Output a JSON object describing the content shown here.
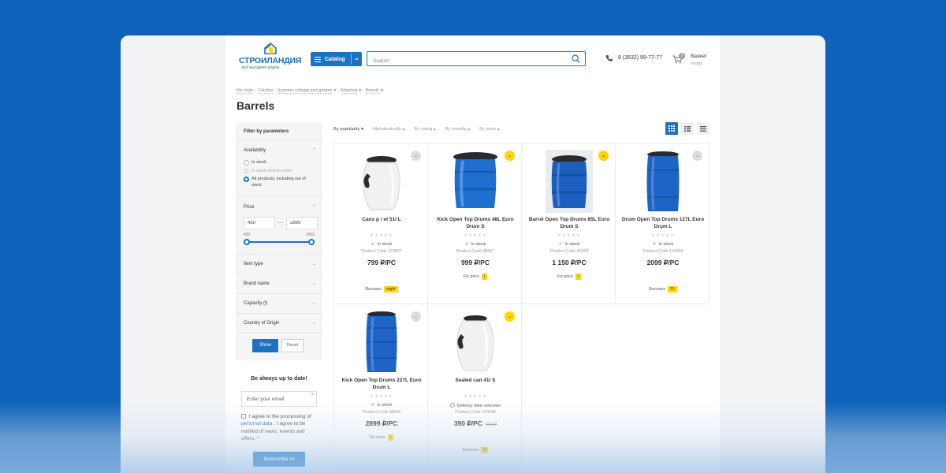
{
  "header": {
    "logo_name": "СТРОИЛАНДИЯ",
    "logo_tagline": "всё выгоднее рядом",
    "catalog_label": "Catalog",
    "search_placeholder": "Search",
    "phone": "8 (3532) 99-77-77",
    "basket": {
      "title": "Basket",
      "subtitle": "empty",
      "count": "0"
    }
  },
  "breadcrumb": [
    "the main",
    "Catalog",
    "Summer cottage and garden",
    "Watering",
    "Barrels"
  ],
  "page_title": "Barrels",
  "filter": {
    "title": "Filter by parameters",
    "availability": {
      "label": "Availability",
      "options": [
        {
          "label": "In stock",
          "checked": false,
          "disabled": false
        },
        {
          "label": "In stock and on order",
          "checked": false,
          "disabled": true
        },
        {
          "label": "All products, including out of stock",
          "checked": true,
          "disabled": false
        }
      ]
    },
    "price": {
      "label": "Price",
      "from": "450",
      "to": "2899",
      "min_label": "450",
      "max_label": "2899"
    },
    "sections": [
      "Item type",
      "Brand name",
      "Capacity (l)",
      "Country of Origin"
    ],
    "show_label": "Show",
    "reset_label": "Reset"
  },
  "newsletter": {
    "title": "Be always up to date!",
    "email_placeholder": "Enter your email",
    "required_mark": "*",
    "agree_before": "I agree to the processing of",
    "agree_link": "personal data",
    "agree_after": ". I agree to be notified of news, events and offers. *",
    "subscribe_label": "Subscribe to"
  },
  "sort": [
    "By popularity",
    "Alphabetically",
    "By rating",
    "By novelty",
    "By price"
  ],
  "products": [
    {
      "name": "Cans p / et 51l L",
      "stock": "In stock",
      "code": "Product Code 223837",
      "price": "799 ₽/PC",
      "old_price": "",
      "extra_label": "Bonuses",
      "extra_value": "eight",
      "badge": "gray",
      "color": "white"
    },
    {
      "name": "Kick Open Top Drums 48L Euro Drum S",
      "stock": "In stock",
      "code": "Product Code 68057",
      "price": "999 ₽/PC",
      "old_price": "",
      "extra_label": "Fix price",
      "extra_value": "i",
      "badge": "yellow",
      "color": "blue"
    },
    {
      "name": "Barrel Open Top Drums 65L Euro Drum S",
      "stock": "In stock",
      "code": "Product Code 40268",
      "price": "1 150 ₽/PC",
      "old_price": "",
      "extra_label": "Fix price",
      "extra_value": "i",
      "badge": "yellow",
      "color": "blue"
    },
    {
      "name": "Drum Open Top Drums 127L Euro Drum L",
      "stock": "In stock",
      "code": "Product Code 142856",
      "price": "2099 ₽/PC",
      "old_price": "",
      "extra_label": "Bonuses",
      "extra_value": "21",
      "badge": "gray",
      "color": "blue"
    },
    {
      "name": "Kick Open Top Drums 227L Euro Drum L",
      "stock": "In stock",
      "code": "Product Code 38926",
      "price": "2899 ₽/PC",
      "old_price": "",
      "extra_label": "Fix price",
      "extra_value": "i",
      "badge": "gray",
      "color": "blue"
    },
    {
      "name": "Sealed can 41l S",
      "stock": "Delivery date unknown",
      "code": "Product Code 223636",
      "price": "390 ₽/PC",
      "old_price": "599 ₽",
      "extra_label": "Bonuses",
      "extra_value": "4",
      "badge": "yellow",
      "color": "white"
    }
  ],
  "colors": {
    "accent": "#1a73c4",
    "background": "#0e62ba",
    "badge_yellow": "#ffd600",
    "stock_green": "#2ea84b"
  }
}
